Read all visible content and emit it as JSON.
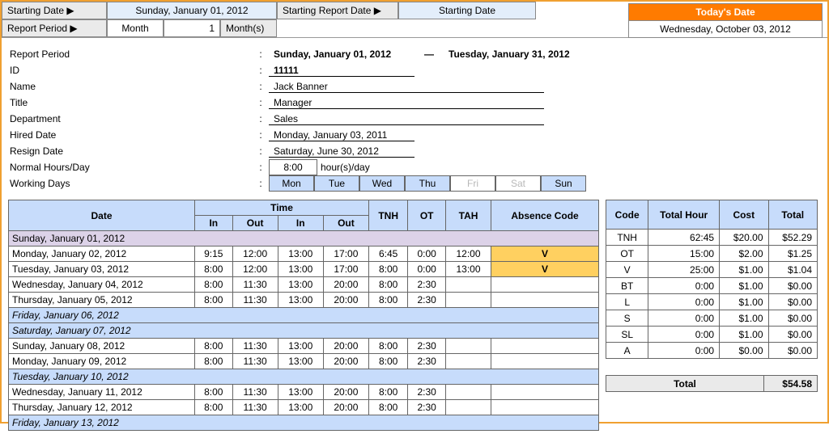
{
  "top": {
    "starting_date_label": "Starting Date ▶",
    "starting_date_value": "Sunday, January 01, 2012",
    "starting_report_label": "Starting Report Date ▶",
    "starting_report_value": "Starting Date",
    "report_period_label": "Report Period ▶",
    "report_period_unit": "Month",
    "report_period_num": "1",
    "report_period_suffix": "Month(s)",
    "today_header": "Today's Date",
    "today_value": "Wednesday, October 03, 2012"
  },
  "info": {
    "period_label": "Report Period",
    "period_start": "Sunday, January 01, 2012",
    "period_end": "Tuesday, January 31, 2012",
    "id_label": "ID",
    "id_value": "11111",
    "name_label": "Name",
    "name_value": "Jack Banner",
    "title_label": "Title",
    "title_value": "Manager",
    "department_label": "Department",
    "department_value": "Sales",
    "hired_label": "Hired Date",
    "hired_value": "Monday, January 03, 2011",
    "resign_label": "Resign Date",
    "resign_value": "Saturday, June 30, 2012",
    "normal_hours_label": "Normal Hours/Day",
    "normal_hours_value": "8:00",
    "normal_hours_suffix": "hour(s)/day",
    "working_days_label": "Working Days",
    "days": {
      "mon": "Mon",
      "tue": "Tue",
      "wed": "Wed",
      "thu": "Thu",
      "fri": "Fri",
      "sat": "Sat",
      "sun": "Sun"
    }
  },
  "chart_data": {
    "type": "table",
    "timesheet": {
      "headers": {
        "date": "Date",
        "time": "Time",
        "in1": "In",
        "out1": "Out",
        "in2": "In",
        "out2": "Out",
        "tnh": "TNH",
        "ot": "OT",
        "tah": "TAH",
        "absence": "Absence Code"
      },
      "rows": [
        {
          "date": "Sunday, January 01, 2012",
          "off": "purple"
        },
        {
          "date": "Monday, January 02, 2012",
          "in1": "9:15",
          "out1": "12:00",
          "in2": "13:00",
          "out2": "17:00",
          "tnh": "6:45",
          "ot": "0:00",
          "tah": "12:00",
          "absence": "V"
        },
        {
          "date": "Tuesday, January 03, 2012",
          "in1": "8:00",
          "out1": "12:00",
          "in2": "13:00",
          "out2": "17:00",
          "tnh": "8:00",
          "ot": "0:00",
          "tah": "13:00",
          "absence": "V"
        },
        {
          "date": "Wednesday, January 04, 2012",
          "in1": "8:00",
          "out1": "11:30",
          "in2": "13:00",
          "out2": "20:00",
          "tnh": "8:00",
          "ot": "2:30"
        },
        {
          "date": "Thursday, January 05, 2012",
          "in1": "8:00",
          "out1": "11:30",
          "in2": "13:00",
          "out2": "20:00",
          "tnh": "8:00",
          "ot": "2:30"
        },
        {
          "date": "Friday, January 06, 2012",
          "off": "blue"
        },
        {
          "date": "Saturday, January 07, 2012",
          "off": "blue"
        },
        {
          "date": "Sunday, January 08, 2012",
          "in1": "8:00",
          "out1": "11:30",
          "in2": "13:00",
          "out2": "20:00",
          "tnh": "8:00",
          "ot": "2:30"
        },
        {
          "date": "Monday, January 09, 2012",
          "in1": "8:00",
          "out1": "11:30",
          "in2": "13:00",
          "out2": "20:00",
          "tnh": "8:00",
          "ot": "2:30"
        },
        {
          "date": "Tuesday, January 10, 2012",
          "off": "blue"
        },
        {
          "date": "Wednesday, January 11, 2012",
          "in1": "8:00",
          "out1": "11:30",
          "in2": "13:00",
          "out2": "20:00",
          "tnh": "8:00",
          "ot": "2:30"
        },
        {
          "date": "Thursday, January 12, 2012",
          "in1": "8:00",
          "out1": "11:30",
          "in2": "13:00",
          "out2": "20:00",
          "tnh": "8:00",
          "ot": "2:30"
        },
        {
          "date": "Friday, January 13, 2012",
          "off": "blue"
        }
      ]
    },
    "summary": {
      "headers": {
        "code": "Code",
        "total_hour": "Total Hour",
        "cost": "Cost",
        "total": "Total"
      },
      "rows": [
        {
          "code": "TNH",
          "hour": "62:45",
          "cost": "$20.00",
          "total": "$52.29"
        },
        {
          "code": "OT",
          "hour": "15:00",
          "cost": "$2.00",
          "total": "$1.25"
        },
        {
          "code": "V",
          "hour": "25:00",
          "cost": "$1.00",
          "total": "$1.04"
        },
        {
          "code": "BT",
          "hour": "0:00",
          "cost": "$1.00",
          "total": "$0.00"
        },
        {
          "code": "L",
          "hour": "0:00",
          "cost": "$1.00",
          "total": "$0.00"
        },
        {
          "code": "S",
          "hour": "0:00",
          "cost": "$1.00",
          "total": "$0.00"
        },
        {
          "code": "SL",
          "hour": "0:00",
          "cost": "$1.00",
          "total": "$0.00"
        },
        {
          "code": "A",
          "hour": "0:00",
          "cost": "$0.00",
          "total": "$0.00"
        }
      ],
      "total_label": "Total",
      "grand_total": "$54.58"
    }
  }
}
